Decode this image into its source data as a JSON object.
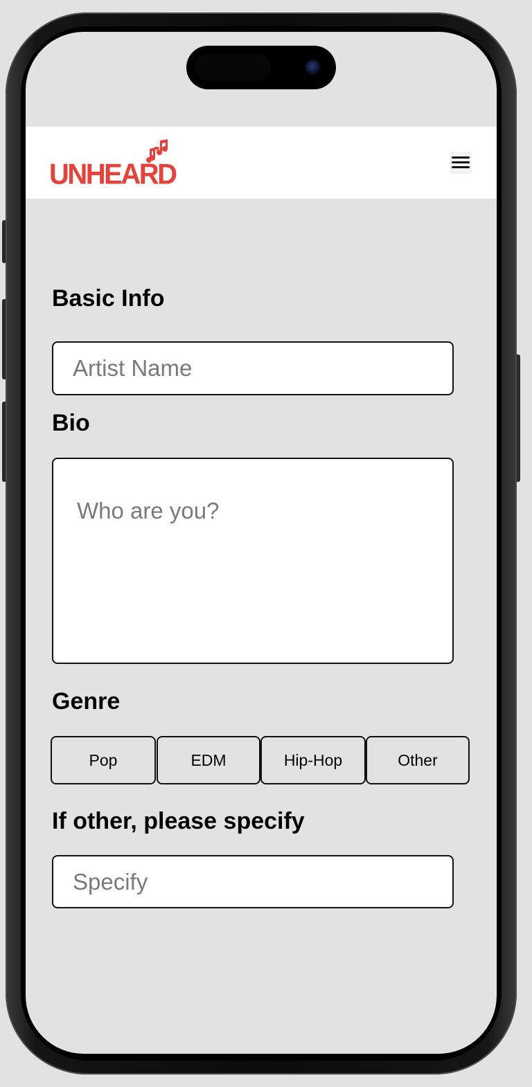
{
  "brand": {
    "name": "UNHEARD",
    "color": "#e8413a"
  },
  "header": {
    "menu_icon": "hamburger-menu-icon"
  },
  "form": {
    "basic_info": {
      "heading": "Basic Info",
      "artist_name_placeholder": "Artist Name",
      "artist_name_value": ""
    },
    "bio": {
      "heading": "Bio",
      "placeholder": "Who are you?",
      "value": ""
    },
    "genre": {
      "heading": "Genre",
      "options": [
        "Pop",
        "EDM",
        "Hip-Hop",
        "Other"
      ]
    },
    "other": {
      "heading": "If other, please specify",
      "placeholder": "Specify",
      "value": ""
    }
  }
}
